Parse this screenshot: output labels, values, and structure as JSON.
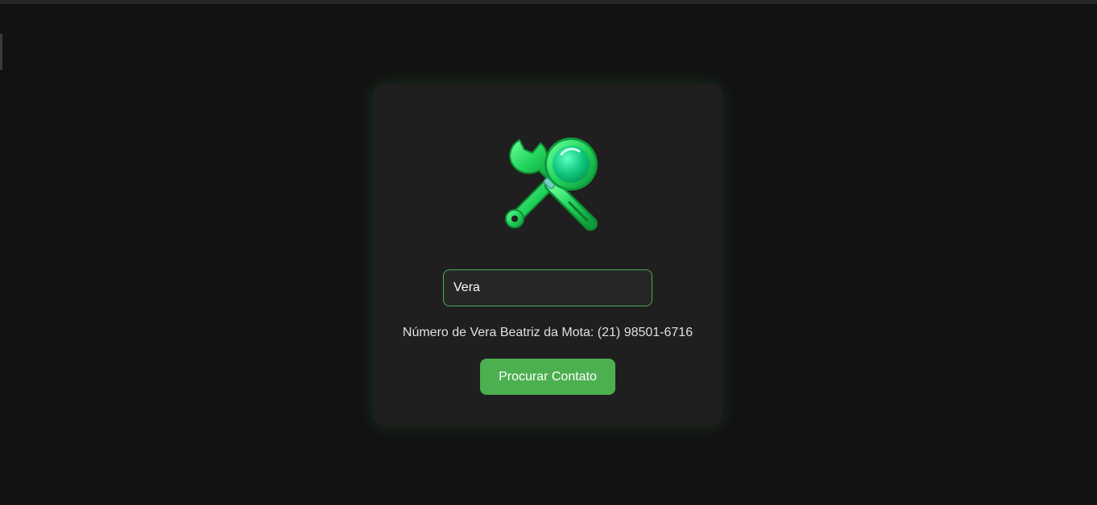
{
  "search": {
    "value": "Vera"
  },
  "result": {
    "text": "Número de Vera Beatriz da Mota: (21) 98501-6716"
  },
  "actions": {
    "search_label": "Procurar Contato"
  },
  "icon": {
    "name": "wrench-and-magnifying-glass-icon"
  },
  "colors": {
    "background": "#121212",
    "card": "#1f1f1f",
    "accent": "#4caf50",
    "input_bg": "#262626",
    "text": "#e0e0e0"
  }
}
